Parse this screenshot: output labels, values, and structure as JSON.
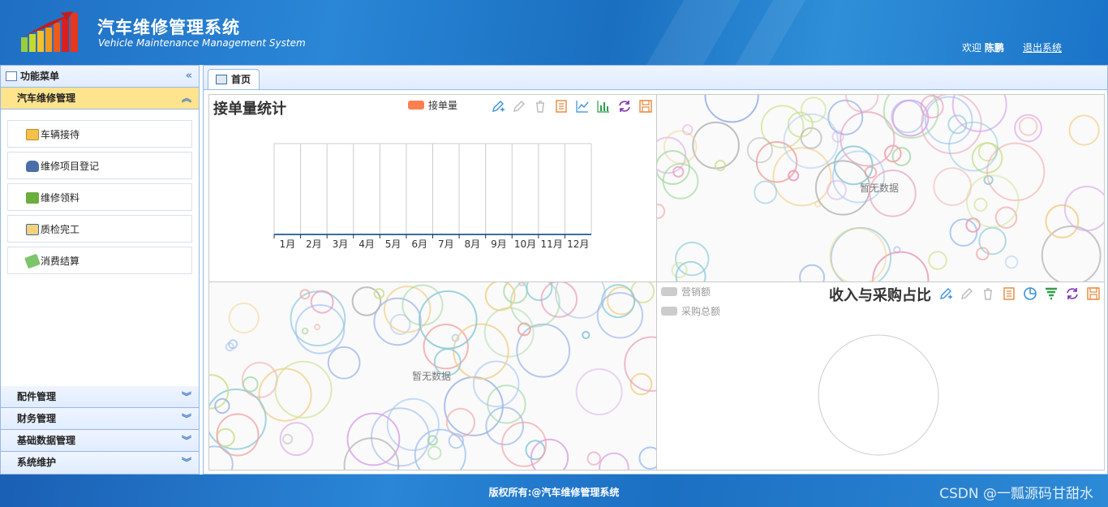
{
  "header": {
    "title": "汽车维修管理系统",
    "subtitle": "Vehicle Maintenance Management System",
    "welcome_prefix": "欢迎",
    "user_name": "陈鹏",
    "logout_label": "退出系统"
  },
  "sidebar": {
    "panel_title": "功能菜单",
    "active_group": "汽车维修管理",
    "items": [
      {
        "label": "车辆接待",
        "icon": "reception-icon"
      },
      {
        "label": "维修项目登记",
        "icon": "car-icon"
      },
      {
        "label": "维修领料",
        "icon": "cart-icon"
      },
      {
        "label": "质检完工",
        "icon": "checklist-icon"
      },
      {
        "label": "消费结算",
        "icon": "money-icon"
      }
    ],
    "groups": [
      "配件管理",
      "财务管理",
      "基础数据管理",
      "系统维护"
    ]
  },
  "tabs": [
    {
      "label": "首页"
    }
  ],
  "charts": {
    "orders": {
      "title": "接单量统计",
      "legend": "接单量"
    },
    "placeholder_top": {
      "text": "暂无数据"
    },
    "placeholder_bottom": {
      "text": "暂无数据"
    },
    "ratio": {
      "title": "收入与采购占比",
      "legend": [
        "营销额",
        "采购总额"
      ]
    }
  },
  "chart_data": [
    {
      "type": "bar",
      "title": "接单量统计",
      "categories": [
        "1月",
        "2月",
        "3月",
        "4月",
        "5月",
        "6月",
        "7月",
        "8月",
        "9月",
        "10月",
        "11月",
        "12月"
      ],
      "series": [
        {
          "name": "接单量",
          "values": [
            0,
            0,
            0,
            0,
            0,
            0,
            0,
            0,
            0,
            0,
            0,
            0
          ]
        }
      ],
      "grid": true,
      "legend": "top-center",
      "color": "#ff7f50"
    },
    {
      "type": "pie",
      "title": "收入与采购占比",
      "categories": [
        "营销额",
        "采购总额"
      ],
      "values": [
        0,
        0
      ],
      "legend": "top-left"
    }
  ],
  "colors": {
    "header": "#1f6fc4",
    "active_group": "#ffe48d",
    "border": "#95b8e7"
  },
  "footer": {
    "copyright": "版权所有:@汽车维修管理系统",
    "watermark": "CSDN @一瓢源码甘甜水"
  }
}
